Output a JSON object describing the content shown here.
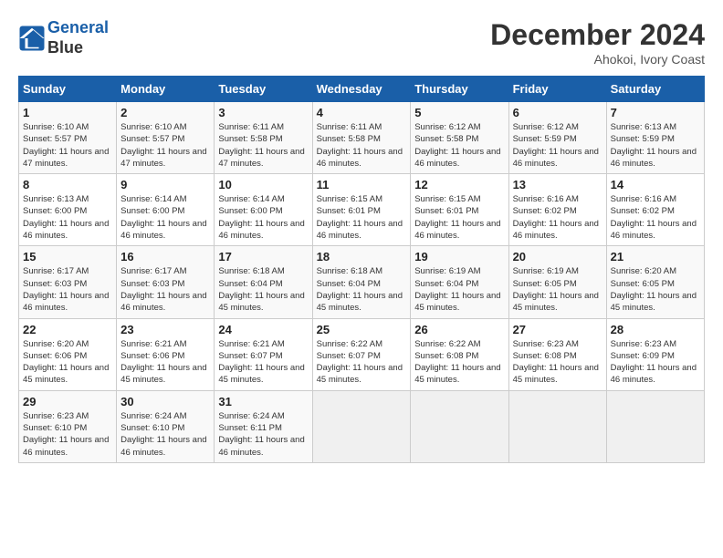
{
  "logo": {
    "line1": "General",
    "line2": "Blue"
  },
  "title": "December 2024",
  "subtitle": "Ahokoi, Ivory Coast",
  "days_header": [
    "Sunday",
    "Monday",
    "Tuesday",
    "Wednesday",
    "Thursday",
    "Friday",
    "Saturday"
  ],
  "weeks": [
    [
      {
        "day": "1",
        "sunrise": "6:10 AM",
        "sunset": "5:57 PM",
        "daylight": "11 hours and 47 minutes."
      },
      {
        "day": "2",
        "sunrise": "6:10 AM",
        "sunset": "5:57 PM",
        "daylight": "11 hours and 47 minutes."
      },
      {
        "day": "3",
        "sunrise": "6:11 AM",
        "sunset": "5:58 PM",
        "daylight": "11 hours and 47 minutes."
      },
      {
        "day": "4",
        "sunrise": "6:11 AM",
        "sunset": "5:58 PM",
        "daylight": "11 hours and 46 minutes."
      },
      {
        "day": "5",
        "sunrise": "6:12 AM",
        "sunset": "5:58 PM",
        "daylight": "11 hours and 46 minutes."
      },
      {
        "day": "6",
        "sunrise": "6:12 AM",
        "sunset": "5:59 PM",
        "daylight": "11 hours and 46 minutes."
      },
      {
        "day": "7",
        "sunrise": "6:13 AM",
        "sunset": "5:59 PM",
        "daylight": "11 hours and 46 minutes."
      }
    ],
    [
      {
        "day": "8",
        "sunrise": "6:13 AM",
        "sunset": "6:00 PM",
        "daylight": "11 hours and 46 minutes."
      },
      {
        "day": "9",
        "sunrise": "6:14 AM",
        "sunset": "6:00 PM",
        "daylight": "11 hours and 46 minutes."
      },
      {
        "day": "10",
        "sunrise": "6:14 AM",
        "sunset": "6:00 PM",
        "daylight": "11 hours and 46 minutes."
      },
      {
        "day": "11",
        "sunrise": "6:15 AM",
        "sunset": "6:01 PM",
        "daylight": "11 hours and 46 minutes."
      },
      {
        "day": "12",
        "sunrise": "6:15 AM",
        "sunset": "6:01 PM",
        "daylight": "11 hours and 46 minutes."
      },
      {
        "day": "13",
        "sunrise": "6:16 AM",
        "sunset": "6:02 PM",
        "daylight": "11 hours and 46 minutes."
      },
      {
        "day": "14",
        "sunrise": "6:16 AM",
        "sunset": "6:02 PM",
        "daylight": "11 hours and 46 minutes."
      }
    ],
    [
      {
        "day": "15",
        "sunrise": "6:17 AM",
        "sunset": "6:03 PM",
        "daylight": "11 hours and 46 minutes."
      },
      {
        "day": "16",
        "sunrise": "6:17 AM",
        "sunset": "6:03 PM",
        "daylight": "11 hours and 46 minutes."
      },
      {
        "day": "17",
        "sunrise": "6:18 AM",
        "sunset": "6:04 PM",
        "daylight": "11 hours and 45 minutes."
      },
      {
        "day": "18",
        "sunrise": "6:18 AM",
        "sunset": "6:04 PM",
        "daylight": "11 hours and 45 minutes."
      },
      {
        "day": "19",
        "sunrise": "6:19 AM",
        "sunset": "6:04 PM",
        "daylight": "11 hours and 45 minutes."
      },
      {
        "day": "20",
        "sunrise": "6:19 AM",
        "sunset": "6:05 PM",
        "daylight": "11 hours and 45 minutes."
      },
      {
        "day": "21",
        "sunrise": "6:20 AM",
        "sunset": "6:05 PM",
        "daylight": "11 hours and 45 minutes."
      }
    ],
    [
      {
        "day": "22",
        "sunrise": "6:20 AM",
        "sunset": "6:06 PM",
        "daylight": "11 hours and 45 minutes."
      },
      {
        "day": "23",
        "sunrise": "6:21 AM",
        "sunset": "6:06 PM",
        "daylight": "11 hours and 45 minutes."
      },
      {
        "day": "24",
        "sunrise": "6:21 AM",
        "sunset": "6:07 PM",
        "daylight": "11 hours and 45 minutes."
      },
      {
        "day": "25",
        "sunrise": "6:22 AM",
        "sunset": "6:07 PM",
        "daylight": "11 hours and 45 minutes."
      },
      {
        "day": "26",
        "sunrise": "6:22 AM",
        "sunset": "6:08 PM",
        "daylight": "11 hours and 45 minutes."
      },
      {
        "day": "27",
        "sunrise": "6:23 AM",
        "sunset": "6:08 PM",
        "daylight": "11 hours and 45 minutes."
      },
      {
        "day": "28",
        "sunrise": "6:23 AM",
        "sunset": "6:09 PM",
        "daylight": "11 hours and 46 minutes."
      }
    ],
    [
      {
        "day": "29",
        "sunrise": "6:23 AM",
        "sunset": "6:10 PM",
        "daylight": "11 hours and 46 minutes."
      },
      {
        "day": "30",
        "sunrise": "6:24 AM",
        "sunset": "6:10 PM",
        "daylight": "11 hours and 46 minutes."
      },
      {
        "day": "31",
        "sunrise": "6:24 AM",
        "sunset": "6:11 PM",
        "daylight": "11 hours and 46 minutes."
      },
      null,
      null,
      null,
      null
    ]
  ]
}
